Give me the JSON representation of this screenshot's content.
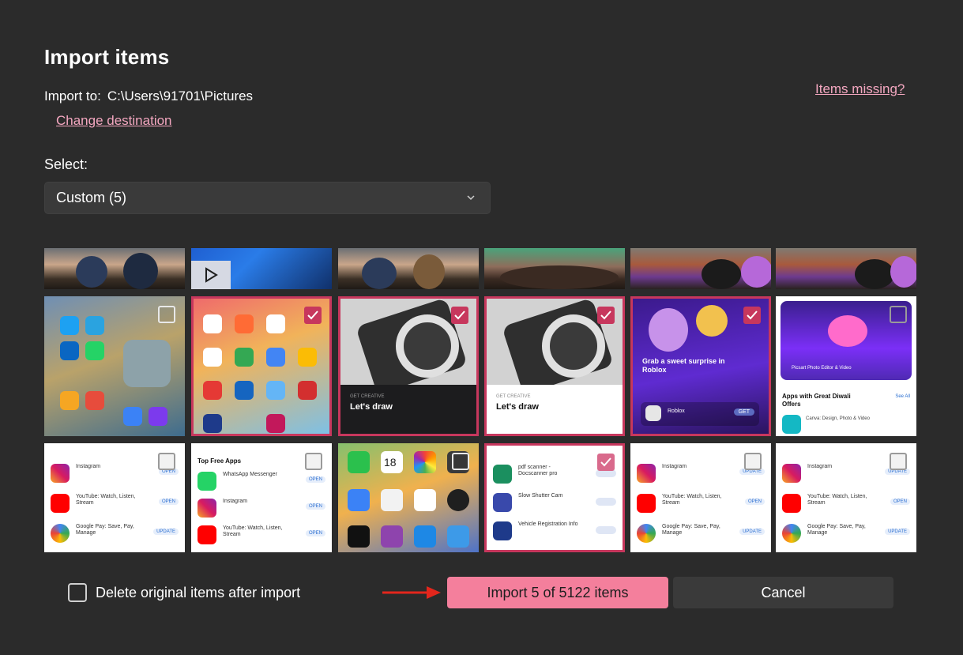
{
  "dialog": {
    "title": "Import items",
    "import_to_label": "Import to:",
    "import_to_path": "C:\\Users\\91701\\Pictures",
    "change_destination": "Change destination",
    "items_missing": "Items missing?",
    "select_label": "Select:",
    "select_value": "Custom (5)"
  },
  "thumbnails": {
    "row2": {
      "t2_caption_kicker": "GET CREATIVE",
      "t2_caption": "Let's draw",
      "t3_caption_kicker": "GET CREATIVE",
      "t3_caption": "Let's draw",
      "t4_caption": "Grab a sweet surprise in Roblox",
      "t4_app": "Roblox",
      "t4_button": "GET",
      "t5_card_title": "Picsart Photo Editor & Video",
      "t5_section": "Apps with Great Diwali Offers",
      "t5_see_all": "See All",
      "t5_subtitle": "Canva: Design, Photo & Video"
    },
    "row3": {
      "t0_row1": "Instagram",
      "t0_row2": "YouTube: Watch, Listen, Stream",
      "t0_row3": "Google Pay: Save, Pay, Manage",
      "t1_header": "Top Free Apps",
      "t1_row1": "WhatsApp Messenger",
      "t1_row2": "Instagram",
      "t1_row3": "YouTube: Watch, Listen, Stream",
      "t3_row1": "pdf scanner - Docscanner pro",
      "t3_row2": "Slow Shutter Cam",
      "t3_row3": "Vehicle Registration Info",
      "t4_row1": "Instagram",
      "t4_row2": "YouTube: Watch, Listen, Stream",
      "t4_row3": "Google Pay: Save, Pay, Manage",
      "t5_row1": "Instagram",
      "t5_row2": "YouTube: Watch, Listen, Stream",
      "t5_row3": "Google Pay: Save, Pay, Manage",
      "open": "OPEN",
      "update": "UPDATE",
      "calendar_day": "18"
    }
  },
  "footer": {
    "delete_label": "Delete original items after import",
    "import_button": "Import 5 of 5122 items",
    "cancel_button": "Cancel"
  },
  "colors": {
    "accent": "#f47f9c",
    "selected_border": "#c7375d",
    "background": "#2b2b2b"
  }
}
